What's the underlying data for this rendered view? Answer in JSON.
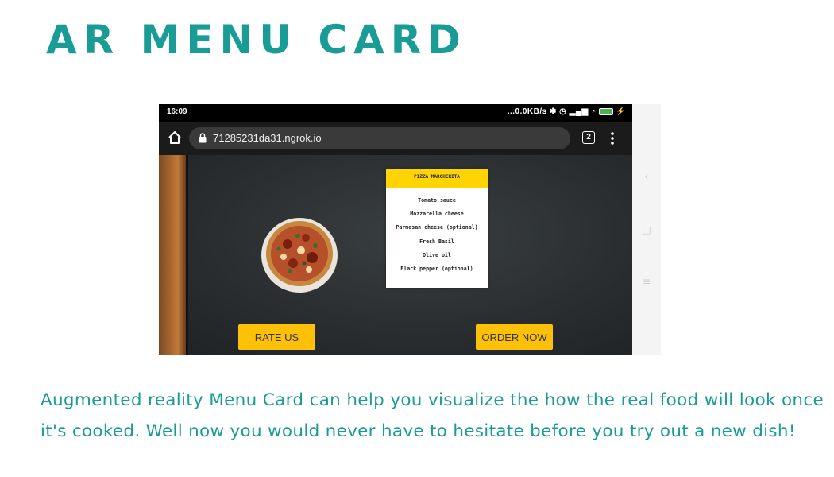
{
  "page": {
    "title": "AR MENU CARD",
    "description": "Augmented reality Menu Card can help you visualize the how the real food will look once it's cooked. Well now you would never have to hesitate before you try out a new dish!"
  },
  "colors": {
    "accent": "#1a9c96",
    "button_yellow": "#ffc107",
    "card_header_yellow": "#ffd400"
  },
  "screenshot": {
    "status_bar": {
      "time": "16:09",
      "indicators": "...0.0KB/s"
    },
    "browser": {
      "url": "71285231da31.ngrok.io",
      "tab_count": "2",
      "icons": [
        "home-icon",
        "lock-icon",
        "tabs-icon",
        "menu-dots-icon"
      ]
    },
    "menu_card": {
      "title": "PIZZA MARGHERITA",
      "ingredients": [
        "Tomato sauce",
        "Mozzarella cheese",
        "Parmesan cheese (optional)",
        "Fresh Basil",
        "Olive oil",
        "Black pepper (optional)"
      ]
    },
    "buttons": {
      "rate": "RATE US",
      "order": "ORDER NOW"
    },
    "nav_icons": [
      "back-icon",
      "home-square-icon",
      "menu-icon"
    ]
  }
}
